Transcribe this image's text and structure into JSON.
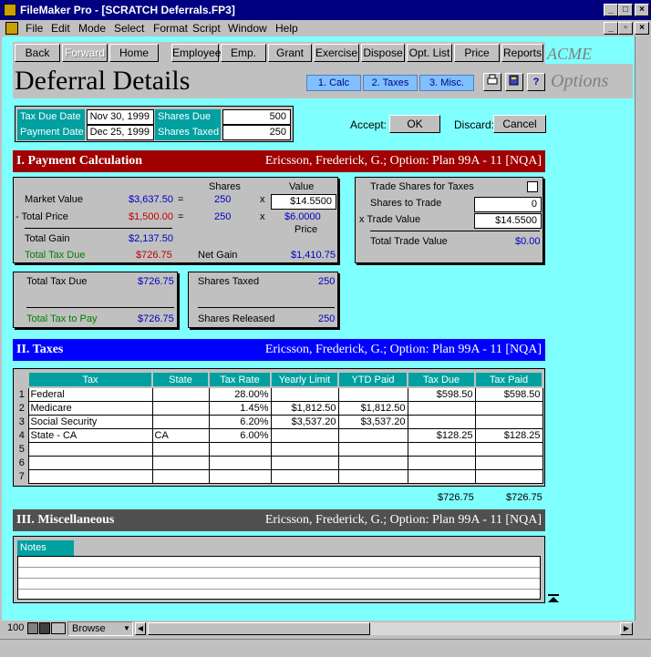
{
  "window": {
    "title": "FileMaker Pro - [SCRATCH Deferrals.FP3]"
  },
  "menu": [
    "File",
    "Edit",
    "Mode",
    "Select",
    "Format",
    "Script",
    "Window",
    "Help"
  ],
  "nav": {
    "back": "Back",
    "forward": "Forward",
    "home": "Home",
    "employee": "Employee",
    "emp_list": "Emp. List",
    "grant": "Grant",
    "exercise": "Exercise",
    "dispose": "Dispose",
    "opt_list": "Opt. List",
    "price": "Price",
    "reports": "Reports",
    "brand": "ACME"
  },
  "header": {
    "title": "Deferral Details",
    "tab1": "1. Calc",
    "tab2": "2. Taxes",
    "tab3": "3. Misc.",
    "options": "Options",
    "help": "?"
  },
  "dates": {
    "tax_due_label": "Tax Due Date",
    "tax_due": "Nov 30, 1999",
    "payment_label": "Payment Date",
    "payment": "Dec 25, 1999",
    "shares_due_label": "Shares Due",
    "shares_due": "500",
    "shares_taxed_label": "Shares Taxed",
    "shares_taxed": "250"
  },
  "actions": {
    "accept_label": "Accept:",
    "ok": "OK",
    "discard_label": "Discard:",
    "cancel": "Cancel"
  },
  "sec1": {
    "title": "I. Payment Calculation",
    "subject": "Ericsson, Frederick, G.; Option: Plan 99A - 11 [NQA]"
  },
  "calc": {
    "shares_h": "Shares",
    "value_h": "Value",
    "market_value_l": "Market Value",
    "market_value": "$3,637.50",
    "eq": "=",
    "mv_shares": "250",
    "x": "x",
    "mv_value": "$14.5500",
    "total_price_l": "- Total Price",
    "total_price": "$1,500.00",
    "tp_shares": "250",
    "tp_value": "$6.0000",
    "price_l": "Price",
    "total_gain_l": "Total Gain",
    "total_gain": "$2,137.50",
    "total_tax_due_l": "Total Tax Due",
    "total_tax_due": "$726.75",
    "net_gain_l": "Net Gain",
    "net_gain": "$1,410.75"
  },
  "trade": {
    "trade_shares_l": "Trade Shares for Taxes",
    "shares_to_trade_l": "Shares to Trade",
    "shares_to_trade": "0",
    "trade_value_l": "x Trade Value",
    "trade_value": "$14.5500",
    "total_trade_value_l": "Total Trade Value",
    "total_trade_value": "$0.00"
  },
  "summary": {
    "total_tax_due_l": "Total Tax Due",
    "total_tax_due": "$726.75",
    "total_tax_pay_l": "Total Tax to Pay",
    "total_tax_pay": "$726.75",
    "shares_taxed_l": "Shares Taxed",
    "shares_taxed": "250",
    "shares_released_l": "Shares Released",
    "shares_released": "250"
  },
  "sec2": {
    "title": "II. Taxes",
    "subject": "Ericsson, Frederick, G.; Option: Plan 99A - 11 [NQA]"
  },
  "taxes": {
    "headers": [
      "Tax",
      "State",
      "Tax Rate",
      "Yearly Limit",
      "YTD Paid",
      "Tax Due",
      "Tax Paid"
    ],
    "rows": [
      [
        "1",
        "Federal",
        "",
        "28.00%",
        "",
        "",
        "$598.50",
        "$598.50"
      ],
      [
        "2",
        "Medicare",
        "",
        "1.45%",
        "$1,812.50",
        "$1,812.50",
        "",
        ""
      ],
      [
        "3",
        "Social Security",
        "",
        "6.20%",
        "$3,537.20",
        "$3,537.20",
        "",
        ""
      ],
      [
        "4",
        "State - CA",
        "CA",
        "6.00%",
        "",
        "",
        "$128.25",
        "$128.25"
      ],
      [
        "5",
        "",
        "",
        "",
        "",
        "",
        "",
        ""
      ],
      [
        "6",
        "",
        "",
        "",
        "",
        "",
        "",
        ""
      ],
      [
        "7",
        "",
        "",
        "",
        "",
        "",
        "",
        ""
      ]
    ],
    "total_due": "$726.75",
    "total_paid": "$726.75"
  },
  "sec3": {
    "title": "III. Miscellaneous",
    "subject": "Ericsson, Frederick, G.; Option: Plan 99A - 11 [NQA]"
  },
  "notes": {
    "label": "Notes"
  },
  "status": {
    "zoom": "100",
    "mode": "Browse"
  },
  "colors": {
    "content_bg": "#80ffff",
    "sec1": "#a00000",
    "sec2": "#0000ff",
    "sec3": "#505050",
    "teal": "#00a0a0"
  }
}
